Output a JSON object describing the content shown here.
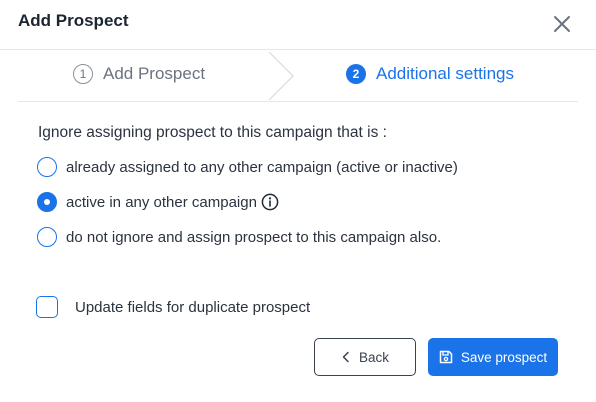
{
  "dialog": {
    "title": "Add Prospect"
  },
  "steps": [
    {
      "number": "1",
      "label": "Add Prospect",
      "state": "inactive"
    },
    {
      "number": "2",
      "label": "Additional settings",
      "state": "active"
    }
  ],
  "settings": {
    "question": "Ignore assigning prospect to this campaign that is :",
    "options": [
      {
        "label": "already assigned to any other campaign (active or inactive)",
        "checked": false
      },
      {
        "label": "active in any other campaign",
        "checked": true
      },
      {
        "label": "do not ignore and assign prospect to this campaign also.",
        "checked": false
      }
    ],
    "update_fields_label": "Update fields for duplicate prospect",
    "update_fields_checked": false
  },
  "footer": {
    "back_label": "Back",
    "save_label": "Save prospect"
  },
  "colors": {
    "accent": "#1a73e8",
    "text": "#1f2a37",
    "muted": "#6b7380"
  },
  "icons": {
    "close": "close-icon",
    "info": "info-icon",
    "back": "chevron-left-icon",
    "save": "save-icon"
  }
}
